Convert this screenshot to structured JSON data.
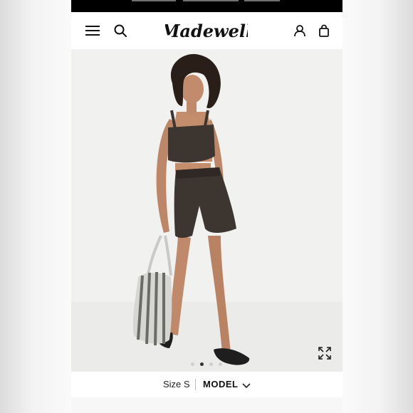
{
  "brand": {
    "logo_text": "Madewell"
  },
  "header": {
    "menu_icon": "menu-icon",
    "search_icon": "search-icon",
    "account_icon": "account-icon",
    "bag_icon": "bag-icon"
  },
  "gallery": {
    "image_alt": "Model wearing dark brown bandeau top and pull-on shorts, holding a striped tote bag",
    "dot_count": 4,
    "active_index": 1,
    "expand_icon": "expand-icon"
  },
  "size_bar": {
    "size_label": "Size S",
    "model_label": "MODEL",
    "chevron_icon": "chevron-down-icon"
  },
  "colors": {
    "outfit": "#3d3530",
    "background": "#f1f1f0",
    "accent": "#111111"
  }
}
